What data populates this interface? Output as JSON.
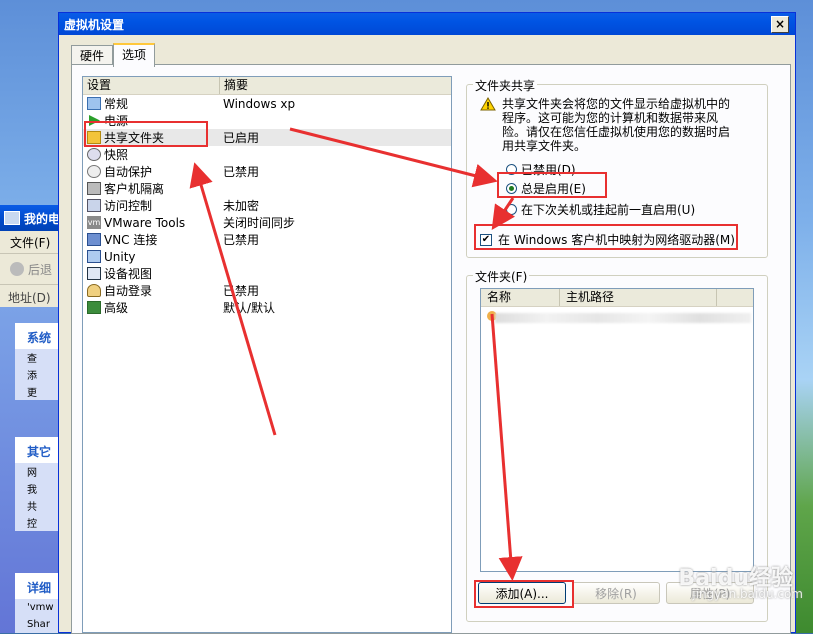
{
  "background_window": {
    "title": "我的电",
    "menu": "文件(F)",
    "back": "后退",
    "address": "地址(D)",
    "panels": [
      {
        "title": "系统",
        "items": [
          "查",
          "添",
          "更"
        ]
      },
      {
        "title": "其它",
        "items": [
          "网",
          "我",
          "共",
          "控"
        ]
      },
      {
        "title": "详细",
        "items": [
          "'vmw",
          "Shar"
        ]
      }
    ]
  },
  "dialog": {
    "title": "虚拟机设置",
    "close": "×",
    "tabs": [
      "硬件",
      "选项"
    ],
    "list": {
      "headers": [
        "设置",
        "摘要"
      ],
      "rows": [
        {
          "name": "常规",
          "summary": "Windows xp",
          "icon": "monitor-icon"
        },
        {
          "name": "电源",
          "summary": "",
          "icon": "power-play-icon"
        },
        {
          "name": "共享文件夹",
          "summary": "已启用",
          "icon": "shared-folder-icon"
        },
        {
          "name": "快照",
          "summary": "",
          "icon": "snapshot-icon"
        },
        {
          "name": "自动保护",
          "summary": "已禁用",
          "icon": "autoprotect-icon"
        },
        {
          "name": "客户机隔离",
          "summary": "",
          "icon": "isolation-icon"
        },
        {
          "name": "访问控制",
          "summary": "未加密",
          "icon": "access-control-icon"
        },
        {
          "name": "VMware Tools",
          "summary": "关闭时间同步",
          "icon": "vmware-tools-icon"
        },
        {
          "name": "VNC 连接",
          "summary": "已禁用",
          "icon": "vnc-icon"
        },
        {
          "name": "Unity",
          "summary": "",
          "icon": "unity-icon"
        },
        {
          "name": "设备视图",
          "summary": "",
          "icon": "device-view-icon"
        },
        {
          "name": "自动登录",
          "summary": "已禁用",
          "icon": "autologin-icon"
        },
        {
          "name": "高级",
          "summary": "默认/默认",
          "icon": "advanced-icon"
        }
      ]
    },
    "sharing": {
      "group_label": "文件夹共享",
      "info": "共享文件夹会将您的文件显示给虚拟机中的程序。这可能为您的计算机和数据带来风险。请仅在您信任虚拟机使用您的数据时启用共享文件夹。",
      "options": [
        {
          "label": "已禁用(D)",
          "selected": false
        },
        {
          "label": "总是启用(E)",
          "selected": true
        },
        {
          "label": "在下次关机或挂起前一直启用(U)",
          "selected": false
        }
      ],
      "map_drive": "在 Windows 客户机中映射为网络驱动器(M)",
      "map_drive_checked": true
    },
    "folders": {
      "group_label": "文件夹(F)",
      "headers": [
        "名称",
        "主机路径"
      ],
      "buttons": {
        "add": "添加(A)...",
        "remove": "移除(R)",
        "properties": "属性(P)"
      }
    }
  },
  "watermark": {
    "brand": "Baidu经验",
    "url": "jingyan.baidu.com"
  },
  "colors": {
    "annotation": "#e83030",
    "accent_title": "#0054e3"
  }
}
